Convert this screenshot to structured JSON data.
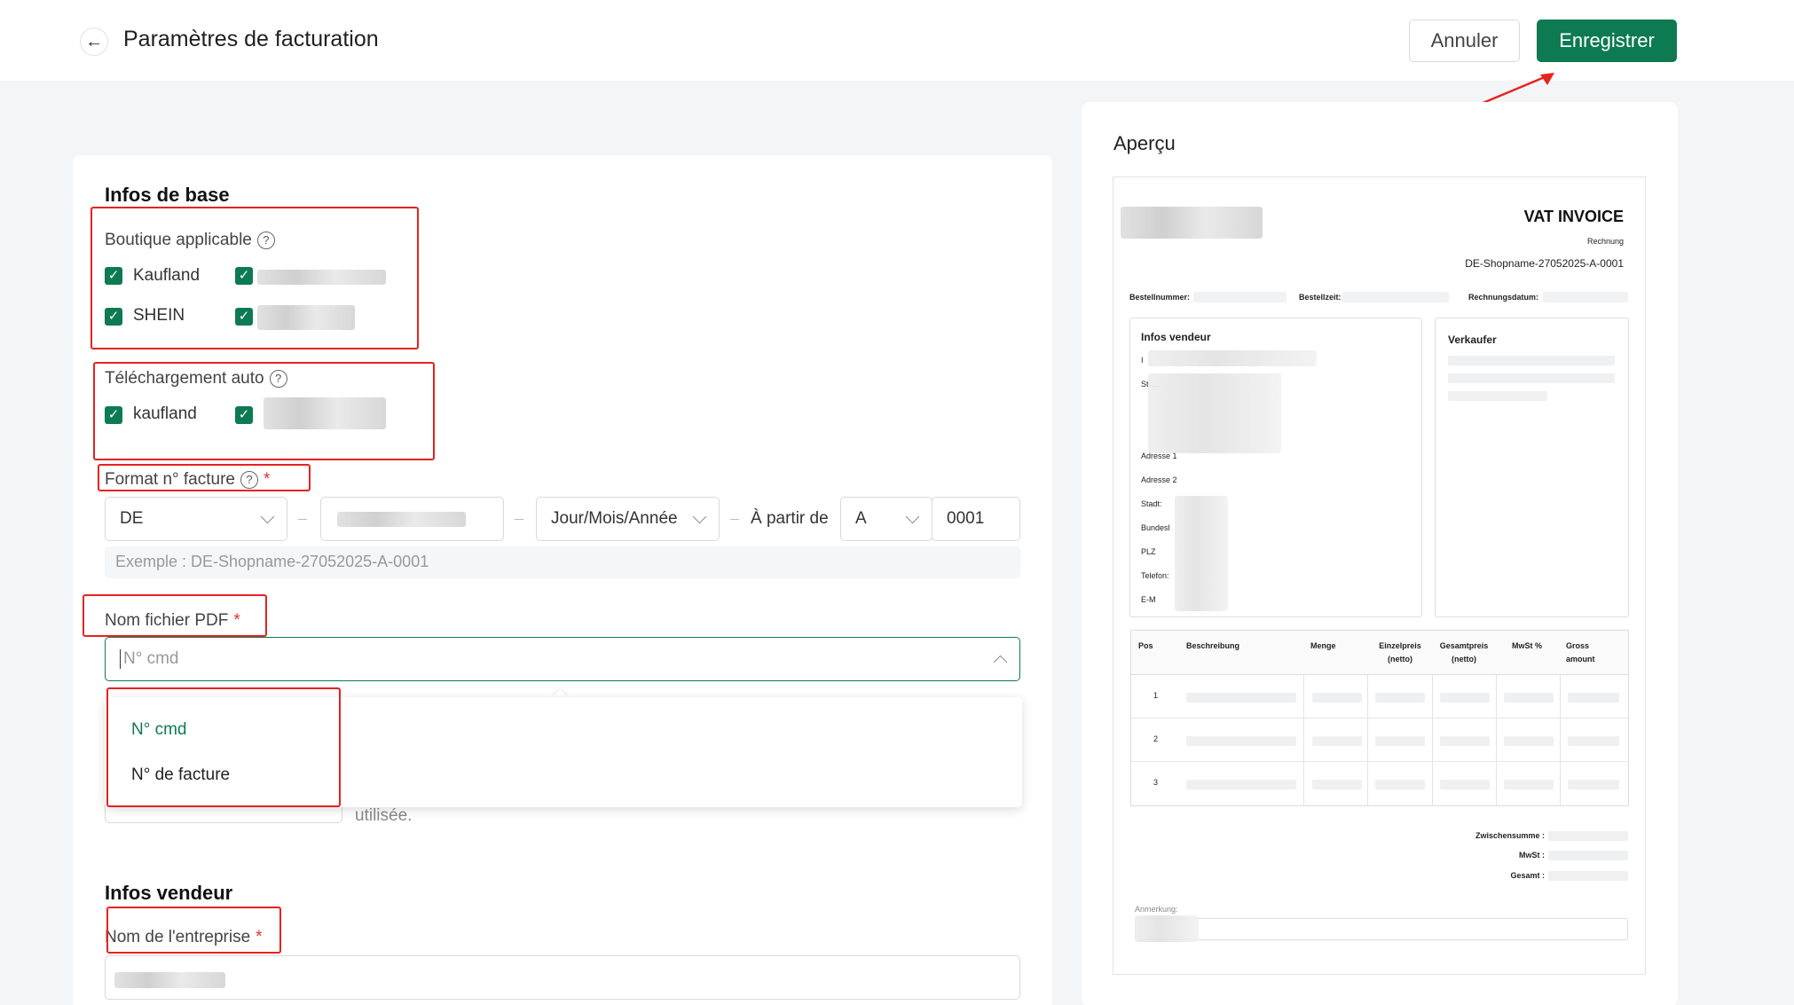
{
  "header": {
    "title": "Paramètres de facturation",
    "cancel_label": "Annuler",
    "save_label": "Enregistrer"
  },
  "basic_info": {
    "section_title": "Infos de base",
    "shop_label": "Boutique applicable",
    "shops": [
      "Kaufland",
      "SHEIN"
    ],
    "auto_upload_label": "Téléchargement auto",
    "auto_upload_shops": [
      "kaufland"
    ],
    "invoice_format_label": "Format n° facture",
    "prefix_value": "DE",
    "date_format_value": "Jour/Mois/Année",
    "from_label": "À partir de",
    "series_value": "A",
    "start_number": "0001",
    "example_text": "Exemple : DE-Shopname-27052025-A-0001",
    "pdf_name_label": "Nom fichier PDF",
    "pdf_name_placeholder": "N° cmd",
    "pdf_options": [
      "N° cmd",
      "N° de facture"
    ],
    "used_text": "utilisée."
  },
  "seller_info": {
    "section_title": "Infos vendeur",
    "company_label": "Nom de l'entreprise"
  },
  "preview": {
    "title": "Aperçu",
    "invoice_title": "VAT INVOICE",
    "invoice_subtitle": "Rechnung",
    "invoice_number": "DE-Shopname-27052025-A-0001",
    "order_number_label": "Bestellnummer:",
    "order_time_label": "Bestellzeit:",
    "invoice_date_label": "Rechnungsdatum:",
    "seller_title": "Infos vendeur",
    "seller_fields": [
      "I",
      "St. ...",
      "Adresse 1",
      "Adresse 2",
      "Stadt:",
      "Bundesl",
      "PLZ",
      "Telefon:",
      "E-M"
    ],
    "buyer_title": "Verkaufer",
    "table_headers": [
      "Pos",
      "Beschreibung",
      "Menge",
      "Einzelpreis (netto)",
      "Gesamtpreis (netto)",
      "MwSt %",
      "Gross amount"
    ],
    "rows": [
      "1",
      "2",
      "3"
    ],
    "subtotal_label": "Zwischensumme :",
    "vat_label": "MwSt :",
    "total_label": "Gesamt :",
    "remark_label": "Anmerkung:"
  },
  "colors": {
    "accent": "#0d7a52",
    "annotation": "#e5231f",
    "required": "#e0302b"
  }
}
